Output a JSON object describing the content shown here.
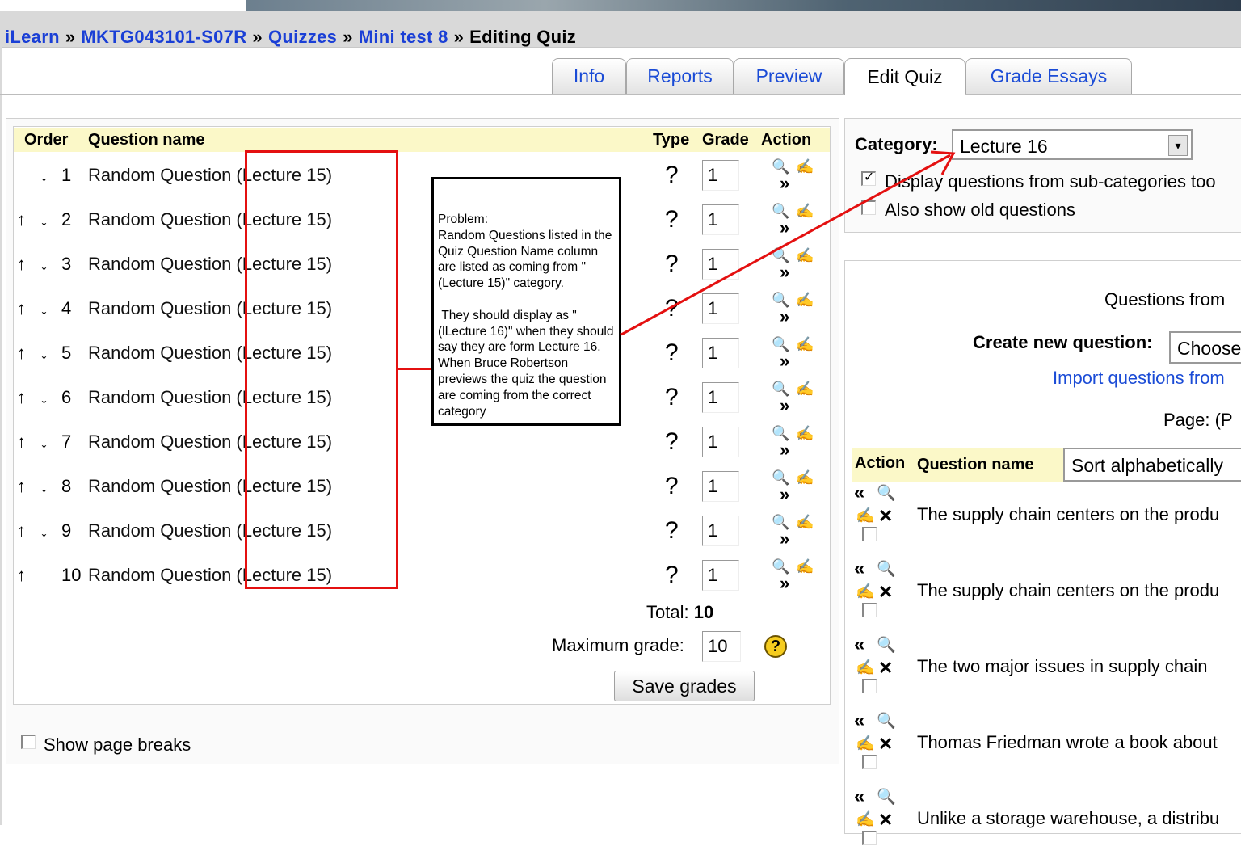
{
  "breadcrumb": {
    "items": [
      "iLearn",
      "MKTG043101-S07R",
      "Quizzes",
      "Mini test 8"
    ],
    "current": "Editing Quiz",
    "separator": "»"
  },
  "tabs": [
    {
      "label": "Info"
    },
    {
      "label": "Reports"
    },
    {
      "label": "Preview"
    },
    {
      "label": "Edit Quiz"
    },
    {
      "label": "Grade Essays"
    }
  ],
  "quiz_table": {
    "headers": {
      "order": "Order",
      "name": "Question name",
      "type": "Type",
      "grade": "Grade",
      "action": "Action"
    },
    "rows": [
      {
        "num": "1",
        "name": "Random Question (Lecture 15)",
        "type": "?",
        "grade": "1"
      },
      {
        "num": "2",
        "name": "Random Question (Lecture 15)",
        "type": "?",
        "grade": "1"
      },
      {
        "num": "3",
        "name": "Random Question (Lecture 15)",
        "type": "?",
        "grade": "1"
      },
      {
        "num": "4",
        "name": "Random Question (Lecture 15)",
        "type": "?",
        "grade": "1"
      },
      {
        "num": "5",
        "name": "Random Question (Lecture 15)",
        "type": "?",
        "grade": "1"
      },
      {
        "num": "6",
        "name": "Random Question (Lecture 15)",
        "type": "?",
        "grade": "1"
      },
      {
        "num": "7",
        "name": "Random Question (Lecture 15)",
        "type": "?",
        "grade": "1"
      },
      {
        "num": "8",
        "name": "Random Question (Lecture 15)",
        "type": "?",
        "grade": "1"
      },
      {
        "num": "9",
        "name": "Random Question (Lecture 15)",
        "type": "?",
        "grade": "1"
      },
      {
        "num": "10",
        "name": "Random Question (Lecture 15)",
        "type": "?",
        "grade": "1"
      }
    ],
    "total_label": "Total:",
    "total_value": "10",
    "max_grade_label": "Maximum grade:",
    "max_grade_value": "10",
    "help_symbol": "?",
    "save_label": "Save grades",
    "show_page_breaks": "Show page breaks"
  },
  "annotation": {
    "text": "Problem:\nRandom Questions listed in the Quiz Question Name column are listed as coming from \"(Lecture 15)\" category.\n\n They should display as \"(lLecture 16)\" when they should say they are form Lecture 16.  When Bruce Robertson previews the quiz the question are coming from the correct category",
    "color": "#e41010"
  },
  "category_panel": {
    "label": "Category:",
    "selected": "Lecture 16",
    "option1": "Display questions from sub-categories too",
    "option1_checked": true,
    "option2": "Also show old questions",
    "option2_checked": false
  },
  "bank_panel": {
    "questions_from": "Questions from",
    "create_label": "Create new question:",
    "create_select": "Choose",
    "import_link": "Import questions from",
    "page_label": "Page: (P",
    "action_header": "Action",
    "name_header": "Question name",
    "sort_select": "Sort alphabetically",
    "questions": [
      "The supply chain centers on the produ",
      "The supply chain centers on the produ",
      "The two major issues in supply chain",
      "Thomas Friedman wrote a book about",
      "Unlike a storage warehouse, a distribu"
    ]
  },
  "icons": {
    "up": "↑",
    "down": "↓",
    "move_right": "»",
    "move_left": "«",
    "search": "🔍",
    "edit": "✍",
    "delete": "✕",
    "dropdown": "▾"
  }
}
